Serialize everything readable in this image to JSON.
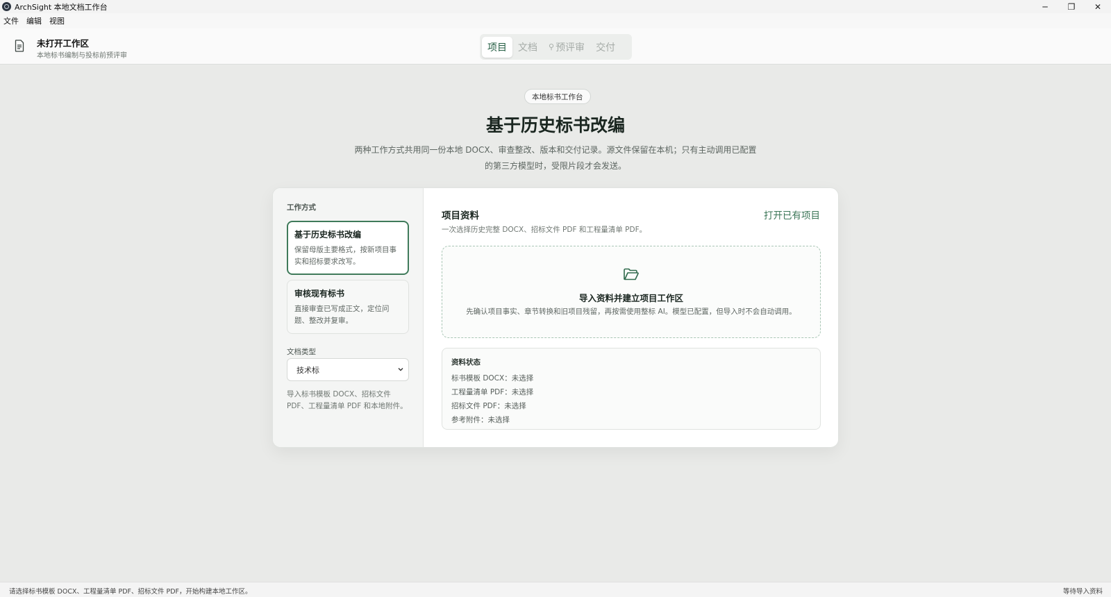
{
  "window": {
    "title": "ArchSight 本地文档工作台",
    "controls": {
      "minimize": "─",
      "restore": "❐",
      "close": "✕"
    }
  },
  "menu": [
    "文件",
    "编辑",
    "视图"
  ],
  "header": {
    "title": "未打开工作区",
    "subtitle": "本地标书编制与投标前预评审",
    "tabs": [
      {
        "label": "项目",
        "active": true
      },
      {
        "label": "文档",
        "active": false
      },
      {
        "label": "预评审",
        "active": false,
        "icon": "search-icon"
      },
      {
        "label": "交付",
        "active": false
      }
    ]
  },
  "hero": {
    "badge": "本地标书工作台",
    "title": "基于历史标书改编",
    "desc_line1": "两种工作方式共用同一份本地 DOCX、审查整改、版本和交付记录。源文件保留在本机；只有主动调用已配置",
    "desc_line2": "的第三方模型时，受限片段才会发送。"
  },
  "left_panel": {
    "section_label": "工作方式",
    "modes": [
      {
        "title": "基于历史标书改编",
        "desc": "保留母版主要格式，按新项目事实和招标要求改写。",
        "selected": true
      },
      {
        "title": "审核现有标书",
        "desc": "直接审查已写成正文，定位问题、整改并复审。",
        "selected": false
      }
    ],
    "doc_type_label": "文档类型",
    "doc_type_value": "技术标",
    "help": "导入标书模板 DOCX、招标文件 PDF、工程量清单 PDF 和本地附件。"
  },
  "right_panel": {
    "title": "项目资料",
    "open_link": "打开已有项目",
    "subtitle": "一次选择历史完整 DOCX、招标文件 PDF 和工程量清单 PDF。",
    "dropzone": {
      "title": "导入资料并建立项目工作区",
      "desc": "先确认项目事实、章节转换和旧项目残留，再按需使用整标 AI。模型已配置，但导入时不会自动调用。"
    },
    "status": {
      "title": "资料状态",
      "lines": [
        "标书模板 DOCX：未选择",
        "工程量清单 PDF：未选择",
        "招标文件 PDF：未选择",
        "参考附件：未选择"
      ]
    }
  },
  "statusbar": {
    "left": "请选择标书模板 DOCX、工程量清单 PDF、招标文件 PDF，开始构建本地工作区。",
    "right": "等待导入资料"
  },
  "colors": {
    "accent": "#3f7a5a",
    "accent_text": "#245e43",
    "background": "#e9eae8"
  }
}
